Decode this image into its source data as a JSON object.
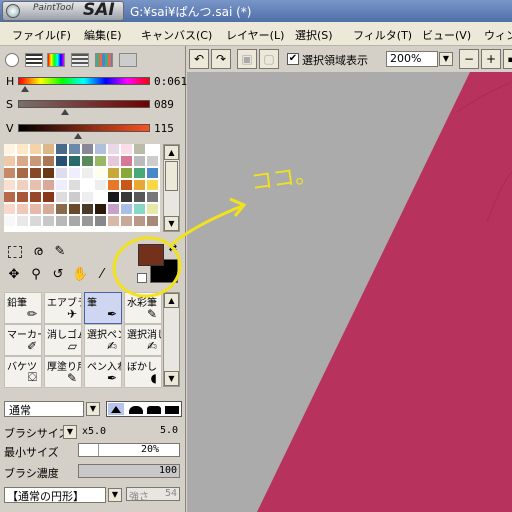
{
  "window": {
    "logo_small": "PaintTool",
    "logo_big": "SAI",
    "title": "G:¥sai¥ぱんつ.sai (*)"
  },
  "menubar": {
    "items": [
      "ファイル(F)",
      "編集(E)",
      "キャンバス(C)",
      "レイヤー(L)",
      "選択(S)",
      "フィルタ(T)",
      "ビュー(V)",
      "ウィン"
    ]
  },
  "color_sliders": {
    "h": {
      "label": "H",
      "value": "0:061"
    },
    "s": {
      "label": "S",
      "value": "089"
    },
    "v": {
      "label": "V",
      "value": "115"
    }
  },
  "colors": {
    "foreground": "#73301b",
    "background": "#000000",
    "canvas_gray": "#ababab",
    "canvas_pink": "#b8325e",
    "annotation_yellow": "#f2e21c"
  },
  "annotation_text": "ココ。",
  "tools": [
    {
      "label": "鉛筆",
      "icon": "pencil-icon"
    },
    {
      "label": "エアブラシ",
      "icon": "airbrush-icon"
    },
    {
      "label": "筆",
      "icon": "brush-icon",
      "selected": true
    },
    {
      "label": "水彩筆",
      "icon": "watercolor-icon"
    },
    {
      "label": "マーカー",
      "icon": "marker-icon"
    },
    {
      "label": "消しゴム",
      "icon": "eraser-icon"
    },
    {
      "label": "選択ペン",
      "icon": "select-pen-icon"
    },
    {
      "label": "選択消し",
      "icon": "select-erase-icon"
    },
    {
      "label": "バケツ",
      "icon": "bucket-icon"
    },
    {
      "label": "厚塗り用",
      "icon": "thick-paint-icon"
    },
    {
      "label": "ペン入れ",
      "icon": "pen-icon"
    },
    {
      "label": "ぼかし",
      "icon": "blur-icon"
    }
  ],
  "brush": {
    "blend_mode": "通常",
    "size_label": "ブラシサイズ",
    "size_multiplier": "x5.0",
    "size_value": "5.0",
    "min_size_label": "最小サイズ",
    "min_size_value": "20%",
    "min_size_fraction": 0.2,
    "density_label": "ブラシ濃度",
    "density_value": "100",
    "density_fraction": 1.0,
    "shape": "【通常の円形】",
    "strength_label": "強さ",
    "strength_value": "54"
  },
  "view_toolbar": {
    "selection_checkbox_label": "選択領域表示",
    "zoom": "200%"
  }
}
